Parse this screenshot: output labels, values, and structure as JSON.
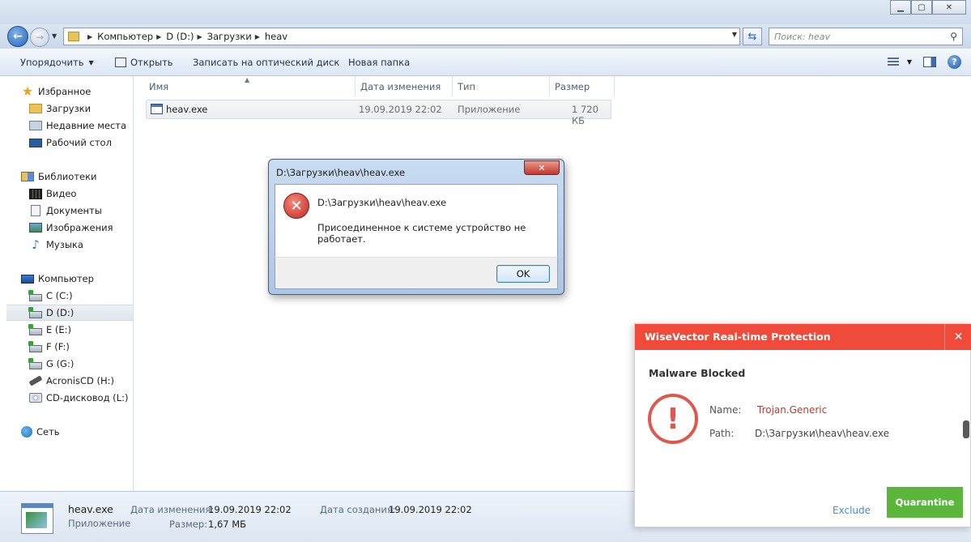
{
  "window": {
    "minimize_glyph": "▁",
    "maximize_glyph": "▢",
    "close_glyph": "✕"
  },
  "address": {
    "crumbs": [
      "Компьютер",
      "D (D:)",
      "Загрузки",
      "heav"
    ],
    "search_placeholder": "Поиск: heav"
  },
  "toolbar": {
    "organize": "Упорядочить",
    "open": "Открыть",
    "burn": "Записать на оптический диск",
    "new_folder": "Новая папка"
  },
  "sidebar": {
    "favorites": {
      "header": "Избранное",
      "items": [
        "Загрузки",
        "Недавние места",
        "Рабочий стол"
      ]
    },
    "libraries": {
      "header": "Библиотеки",
      "items": [
        "Видео",
        "Документы",
        "Изображения",
        "Музыка"
      ]
    },
    "computer": {
      "header": "Компьютер",
      "items": [
        "C (C:)",
        "D (D:)",
        "E (E:)",
        "F (F:)",
        "G (G:)",
        "AcronisCD (H:)",
        "CD-дисковод (L:)"
      ]
    },
    "network": {
      "header": "Сеть"
    }
  },
  "filelist": {
    "columns": [
      "Имя",
      "Дата изменения",
      "Тип",
      "Размер"
    ],
    "rows": [
      {
        "name": "heav.exe",
        "modified": "19.09.2019 22:02",
        "type": "Приложение",
        "size": "1 720 КБ"
      }
    ]
  },
  "details": {
    "name": "heav.exe",
    "kind": "Приложение",
    "modified_label": "Дата изменения:",
    "modified_value": "19.09.2019 22:02",
    "created_label": "Дата создания:",
    "created_value": "19.09.2019 22:02",
    "size_label": "Размер:",
    "size_value": "1,67 МБ"
  },
  "dialog": {
    "title": "D:\\Загрузки\\heav\\heav.exe",
    "path": "D:\\Загрузки\\heav\\heav.exe",
    "message": "Присоединенное к системе устройство не работает.",
    "ok_label": "OK"
  },
  "wisevector": {
    "title": "WiseVector Real-time Protection",
    "heading": "Malware Blocked",
    "name_label": "Name:",
    "name_value": "Trojan.Generic",
    "path_label": "Path:",
    "path_value": "D:\\Загрузки\\heav\\heav.exe",
    "exclude_label": "Exclude",
    "quarantine_label": "Quarantine",
    "accent_color": "#ef4a3a",
    "button_color": "#5bb73b"
  }
}
